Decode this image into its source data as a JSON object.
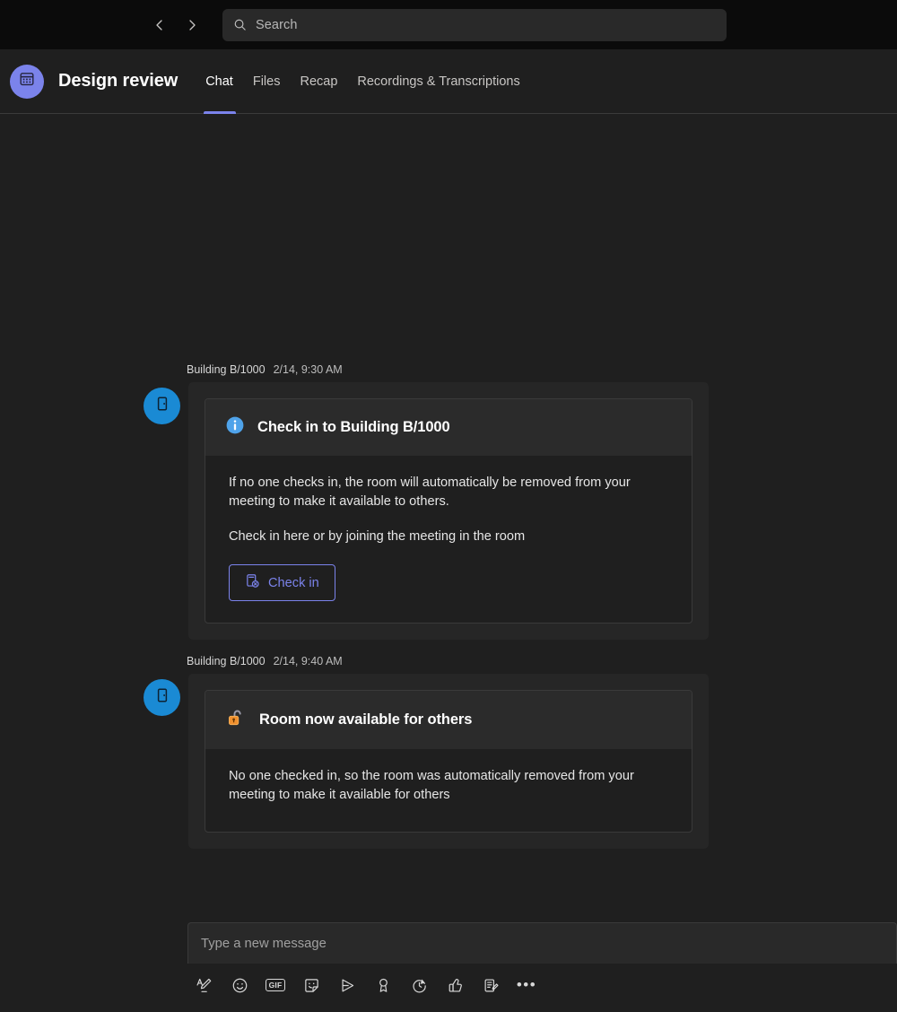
{
  "topbar": {
    "back_icon": "chevron-left-icon",
    "forward_icon": "chevron-right-icon",
    "search": {
      "icon": "search-icon",
      "placeholder": "Search",
      "value": ""
    }
  },
  "header": {
    "avatar_icon": "calendar-icon",
    "title": "Design review",
    "tabs": [
      {
        "label": "Chat",
        "active": true
      },
      {
        "label": "Files",
        "active": false
      },
      {
        "label": "Recap",
        "active": false
      },
      {
        "label": "Recordings & Transcriptions",
        "active": false
      }
    ]
  },
  "messages": [
    {
      "sender": "Building B/1000",
      "timestamp": "2/14, 9:30 AM",
      "avatar_icon": "door-icon",
      "card": {
        "head_icon": "info-icon",
        "head_title": "Check in to Building B/1000",
        "paragraphs": [
          "If no one checks in, the room will automatically be removed from your meeting to make it available to others.",
          "Check in here or by joining the meeting in the room"
        ],
        "button": {
          "label": "Check in",
          "icon": "device-check-in-icon"
        }
      }
    },
    {
      "sender": "Building B/1000",
      "timestamp": "2/14, 9:40 AM",
      "avatar_icon": "door-icon",
      "card": {
        "head_icon": "unlocked-padlock-icon",
        "head_title": "Room now available for others",
        "paragraphs": [
          "No one checked in, so the room was automatically removed from your meeting to make it available for others"
        ],
        "button": null
      }
    }
  ],
  "compose": {
    "placeholder": "Type a new message",
    "value": "",
    "tools": [
      {
        "name": "format-icon",
        "label": "Format"
      },
      {
        "name": "emoji-icon",
        "label": "Emoji"
      },
      {
        "name": "gif-icon",
        "label": "GIF"
      },
      {
        "name": "sticker-icon",
        "label": "Sticker"
      },
      {
        "name": "loop-component-icon",
        "label": "Loop component"
      },
      {
        "name": "praise-icon",
        "label": "Praise"
      },
      {
        "name": "schedule-send-icon",
        "label": "Schedule send"
      },
      {
        "name": "approvals-icon",
        "label": "Approvals"
      },
      {
        "name": "forms-icon",
        "label": "Forms"
      },
      {
        "name": "more-options-icon",
        "label": "More options"
      }
    ]
  },
  "colors": {
    "accent_purple": "#7b83eb",
    "avatar_blue": "#1a8ad4",
    "info_blue": "#4fa3ea",
    "lock_orange": "#f5a23c",
    "app_background": "#1f1f1f",
    "topbar_background": "#0b0b0b",
    "bubble_background": "#262626"
  }
}
